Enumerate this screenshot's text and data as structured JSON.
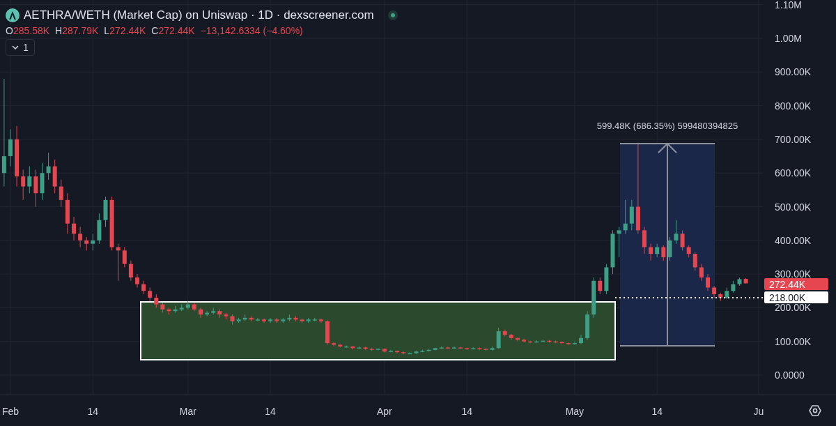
{
  "header": {
    "title": "AETHRA/WETH (Market Cap) on Uniswap · 1D · dexscreener.com",
    "ohlc": [
      {
        "label": "O",
        "value": "285.58K"
      },
      {
        "label": "H",
        "value": "287.79K"
      },
      {
        "label": "L",
        "value": "272.44K"
      },
      {
        "label": "C",
        "value": "272.44K"
      }
    ],
    "change": "−13,142.6334 (−4.60%)",
    "indicators": {
      "count": "1",
      "expanded": false
    }
  },
  "chart": {
    "chart_data": {
      "type": "candlestick",
      "categories": [
        null,
        "Feb",
        null,
        null,
        null,
        null,
        null,
        null,
        null,
        null,
        null,
        null,
        null,
        null,
        "14",
        null,
        null,
        null,
        null,
        null,
        null,
        null,
        null,
        null,
        null,
        null,
        null,
        null,
        null,
        "Mar",
        null,
        null,
        null,
        null,
        null,
        null,
        null,
        null,
        null,
        null,
        null,
        null,
        "14",
        null,
        null,
        null,
        null,
        null,
        null,
        null,
        null,
        null,
        null,
        null,
        null,
        null,
        null,
        null,
        null,
        null,
        "Apr",
        null,
        null,
        null,
        null,
        null,
        null,
        null,
        null,
        null,
        null,
        null,
        null,
        "14",
        null,
        null,
        null,
        null,
        null,
        null,
        null,
        null,
        null,
        null,
        null,
        null,
        null,
        null,
        null,
        null,
        "May",
        null,
        null,
        null,
        null,
        null,
        null,
        null,
        null,
        null,
        null,
        null,
        null,
        "14",
        null,
        null,
        null,
        null,
        null,
        null,
        null,
        null,
        null,
        null,
        null,
        null,
        null,
        null,
        null,
        "Ju"
      ],
      "ohlc": [
        [
          600000,
          880000,
          560000,
          650000
        ],
        [
          650000,
          730000,
          620000,
          700000
        ],
        [
          700000,
          740000,
          560000,
          590000
        ],
        [
          590000,
          610000,
          520000,
          560000
        ],
        [
          560000,
          620000,
          540000,
          590000
        ],
        [
          590000,
          610000,
          500000,
          540000
        ],
        [
          540000,
          630000,
          520000,
          600000
        ],
        [
          600000,
          660000,
          580000,
          620000
        ],
        [
          620000,
          640000,
          540000,
          560000
        ],
        [
          560000,
          580000,
          500000,
          520000
        ],
        [
          520000,
          540000,
          420000,
          450000
        ],
        [
          450000,
          470000,
          400000,
          420000
        ],
        [
          420000,
          440000,
          380000,
          400000
        ],
        [
          400000,
          410000,
          370000,
          390000
        ],
        [
          390000,
          420000,
          370000,
          400000
        ],
        [
          400000,
          480000,
          390000,
          460000
        ],
        [
          460000,
          530000,
          440000,
          520000
        ],
        [
          520000,
          530000,
          370000,
          380000
        ],
        [
          380000,
          390000,
          280000,
          370000
        ],
        [
          370000,
          380000,
          320000,
          330000
        ],
        [
          330000,
          340000,
          280000,
          290000
        ],
        [
          290000,
          300000,
          260000,
          270000
        ],
        [
          270000,
          280000,
          240000,
          250000
        ],
        [
          250000,
          260000,
          220000,
          230000
        ],
        [
          230000,
          240000,
          200000,
          210000
        ],
        [
          210000,
          215000,
          185000,
          195000
        ],
        [
          195000,
          200000,
          180000,
          190000
        ],
        [
          190000,
          205000,
          185000,
          195000
        ],
        [
          195000,
          210000,
          190000,
          200000
        ],
        [
          200000,
          220000,
          195000,
          210000
        ],
        [
          210000,
          215000,
          190000,
          195000
        ],
        [
          195000,
          200000,
          170000,
          180000
        ],
        [
          180000,
          190000,
          175000,
          185000
        ],
        [
          185000,
          200000,
          180000,
          190000
        ],
        [
          190000,
          195000,
          170000,
          180000
        ],
        [
          180000,
          185000,
          165000,
          175000
        ],
        [
          175000,
          180000,
          150000,
          160000
        ],
        [
          160000,
          170000,
          155000,
          165000
        ],
        [
          165000,
          180000,
          160000,
          170000
        ],
        [
          170000,
          175000,
          160000,
          165000
        ],
        [
          165000,
          170000,
          160000,
          165000
        ],
        [
          165000,
          168000,
          155000,
          160000
        ],
        [
          160000,
          170000,
          155000,
          165000
        ],
        [
          165000,
          170000,
          155000,
          160000
        ],
        [
          160000,
          170000,
          155000,
          165000
        ],
        [
          165000,
          180000,
          160000,
          170000
        ],
        [
          170000,
          175000,
          160000,
          165000
        ],
        [
          165000,
          168000,
          155000,
          160000
        ],
        [
          160000,
          170000,
          155000,
          165000
        ],
        [
          165000,
          170000,
          160000,
          165000
        ],
        [
          165000,
          168000,
          155000,
          160000
        ],
        [
          160000,
          162000,
          90000,
          95000
        ],
        [
          95000,
          98000,
          85000,
          90000
        ],
        [
          90000,
          92000,
          82000,
          85000
        ],
        [
          85000,
          88000,
          82000,
          85000
        ],
        [
          85000,
          86000,
          76000,
          80000
        ],
        [
          80000,
          85000,
          78000,
          82000
        ],
        [
          82000,
          84000,
          75000,
          78000
        ],
        [
          78000,
          80000,
          72000,
          75000
        ],
        [
          75000,
          80000,
          73000,
          78000
        ],
        [
          78000,
          79000,
          67000,
          70000
        ],
        [
          70000,
          75000,
          68000,
          72000
        ],
        [
          72000,
          73000,
          65000,
          68000
        ],
        [
          68000,
          70000,
          62000,
          65000
        ],
        [
          65000,
          68000,
          62000,
          65000
        ],
        [
          65000,
          72000,
          63000,
          70000
        ],
        [
          70000,
          75000,
          68000,
          72000
        ],
        [
          72000,
          78000,
          70000,
          75000
        ],
        [
          75000,
          82000,
          73000,
          80000
        ],
        [
          80000,
          85000,
          78000,
          82000
        ],
        [
          82000,
          84000,
          78000,
          80000
        ],
        [
          80000,
          85000,
          78000,
          82000
        ],
        [
          82000,
          84000,
          78000,
          80000
        ],
        [
          80000,
          82000,
          75000,
          78000
        ],
        [
          78000,
          82000,
          76000,
          80000
        ],
        [
          80000,
          82000,
          75000,
          78000
        ],
        [
          78000,
          80000,
          72000,
          75000
        ],
        [
          75000,
          85000,
          73000,
          80000
        ],
        [
          80000,
          140000,
          78000,
          130000
        ],
        [
          130000,
          135000,
          115000,
          120000
        ],
        [
          120000,
          122000,
          105000,
          110000
        ],
        [
          110000,
          112000,
          100000,
          105000
        ],
        [
          105000,
          108000,
          98000,
          100000
        ],
        [
          100000,
          102000,
          95000,
          98000
        ],
        [
          98000,
          103000,
          96000,
          100000
        ],
        [
          100000,
          105000,
          98000,
          102000
        ],
        [
          102000,
          104000,
          97000,
          100000
        ],
        [
          100000,
          102000,
          95000,
          98000
        ],
        [
          98000,
          100000,
          92000,
          95000
        ],
        [
          95000,
          97000,
          90000,
          92000
        ],
        [
          92000,
          100000,
          90000,
          95000
        ],
        [
          95000,
          120000,
          92000,
          110000
        ],
        [
          110000,
          190000,
          105000,
          180000
        ],
        [
          180000,
          290000,
          170000,
          280000
        ],
        [
          280000,
          290000,
          240000,
          250000
        ],
        [
          250000,
          330000,
          240000,
          320000
        ],
        [
          320000,
          430000,
          300000,
          420000
        ],
        [
          420000,
          440000,
          350000,
          430000
        ],
        [
          430000,
          520000,
          420000,
          450000
        ],
        [
          450000,
          520000,
          430000,
          500000
        ],
        [
          500000,
          690000,
          420000,
          430000
        ],
        [
          430000,
          440000,
          360000,
          380000
        ],
        [
          380000,
          390000,
          340000,
          360000
        ],
        [
          360000,
          390000,
          350000,
          380000
        ],
        [
          380000,
          385000,
          340000,
          350000
        ],
        [
          350000,
          410000,
          340000,
          400000
        ],
        [
          400000,
          460000,
          390000,
          420000
        ],
        [
          420000,
          430000,
          370000,
          380000
        ],
        [
          380000,
          385000,
          350000,
          360000
        ],
        [
          360000,
          365000,
          310000,
          320000
        ],
        [
          320000,
          330000,
          280000,
          290000
        ],
        [
          290000,
          300000,
          250000,
          260000
        ],
        [
          260000,
          265000,
          230000,
          240000
        ],
        [
          240000,
          245000,
          220000,
          230000
        ],
        [
          230000,
          260000,
          225000,
          250000
        ],
        [
          250000,
          280000,
          245000,
          270000
        ],
        [
          270000,
          290000,
          265000,
          285000
        ],
        [
          285580,
          287790,
          272440,
          272440
        ],
        null,
        null
      ],
      "grid": true,
      "ylim": [
        0,
        1100000
      ],
      "yticks": [
        {
          "value": 1100000,
          "label": "1.10M"
        },
        {
          "value": 1000000,
          "label": "1.00M"
        },
        {
          "value": 900000,
          "label": "900.00K"
        },
        {
          "value": 800000,
          "label": "800.00K"
        },
        {
          "value": 700000,
          "label": "700.00K"
        },
        {
          "value": 600000,
          "label": "600.00K"
        },
        {
          "value": 500000,
          "label": "500.00K"
        },
        {
          "value": 400000,
          "label": "400.00K"
        },
        {
          "value": 300000,
          "label": "300.00K"
        },
        {
          "value": 200000,
          "label": "200.00K"
        },
        {
          "value": 100000,
          "label": "100.00K"
        },
        {
          "value": 0,
          "label": "0.0000"
        }
      ]
    }
  },
  "price_tags": [
    {
      "kind": "last",
      "text": "272.44K"
    },
    {
      "kind": "line",
      "text": "218.00K"
    }
  ],
  "measure": {
    "label": "599.48K (686.35%) 599480394825"
  }
}
